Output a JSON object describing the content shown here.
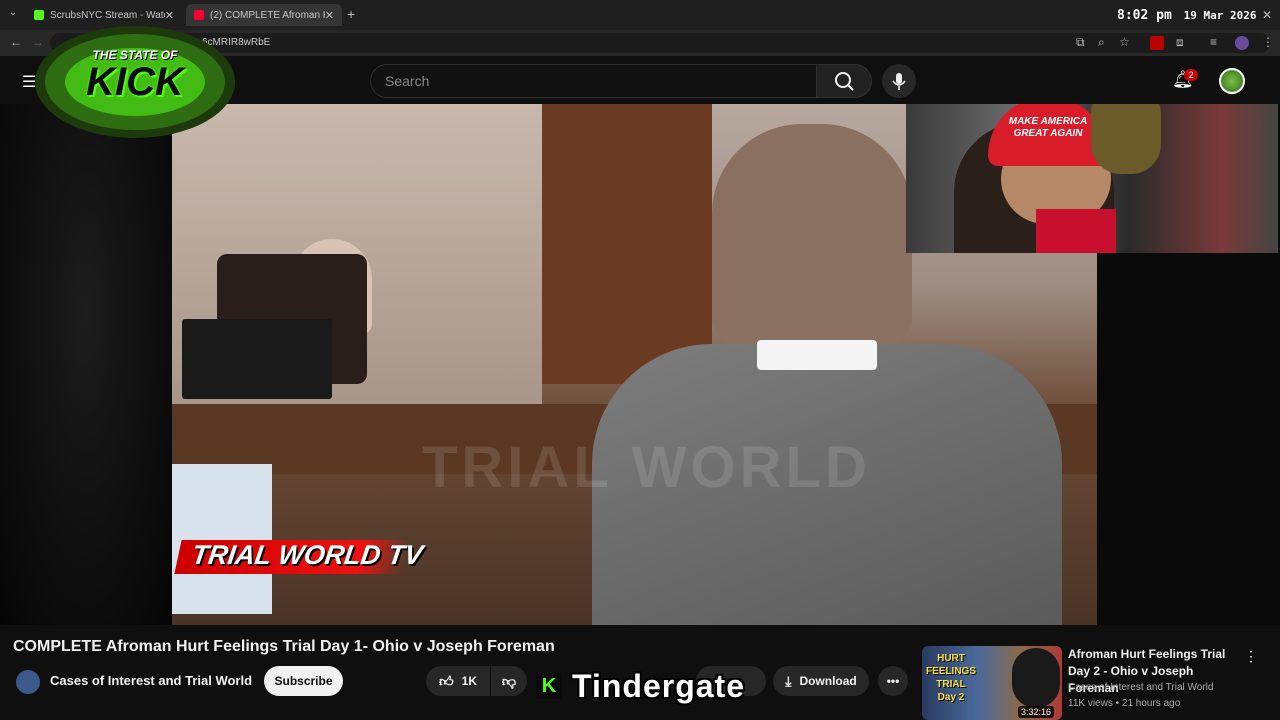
{
  "browser": {
    "tabs": [
      {
        "label": "ScrubsNYC Stream - Watch Live",
        "color": "#53fc18"
      },
      {
        "label": "(2) COMPLETE Afroman Hurt Fe",
        "color": "#ff0033"
      }
    ],
    "url_fragment": "6cMRIR8wRbE"
  },
  "clock": {
    "time": "8:02 pm",
    "date": "19 Mar 2026"
  },
  "youtube": {
    "search_placeholder": "Search",
    "notification_count": "2"
  },
  "video": {
    "watermark": "TRIAL WORLD",
    "banner_text": "TRIAL WORLD TV",
    "title": "COMPLETE Afroman Hurt Feelings Trial Day 1- Ohio v Joseph Foreman",
    "channel": "Cases of Interest and Trial World",
    "subscribe_label": "Subscribe",
    "like_count": "1K",
    "download_label": "Download"
  },
  "overlay": {
    "logo_text_top": "THE STATE OF",
    "logo_text_main": "KICK",
    "ticker_icon": "K",
    "ticker_text": "Tindergate",
    "webcam_hat_text": "MAKE AMERICA GREAT AGAIN"
  },
  "recommended": {
    "thumb_label": "HURT FEELINGS TRIAL Day 2",
    "duration": "3:32:16",
    "title": "Afroman Hurt Feelings Trial Day 2 - Ohio v Joseph Foreman",
    "channel": "Cases of Interest and Trial World",
    "meta": "11K views • 21 hours ago"
  },
  "colors": {
    "kick_green": "#53fc18",
    "youtube_red": "#ff0033"
  }
}
